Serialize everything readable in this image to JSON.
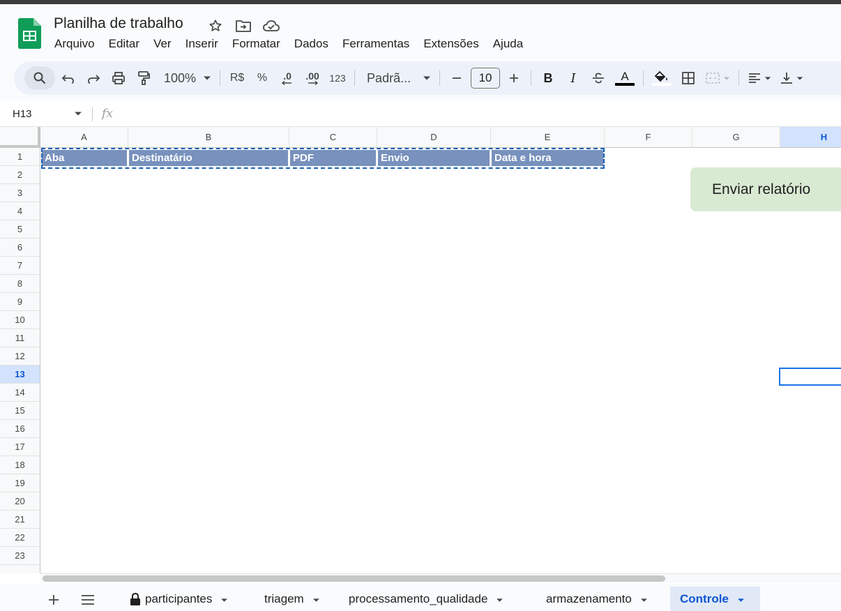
{
  "app": {
    "doc_title": "Planilha de trabalho",
    "title_icons": [
      "star-icon",
      "move-folder-icon",
      "cloud-saved-icon"
    ]
  },
  "menu": [
    "Arquivo",
    "Editar",
    "Ver",
    "Inserir",
    "Formatar",
    "Dados",
    "Ferramentas",
    "Extensões",
    "Ajuda"
  ],
  "toolbar": {
    "zoom": "100%",
    "currency": "R$",
    "percent": "%",
    "decrease_decimals": ".0",
    "increase_decimals": ".00",
    "more_formats": "123",
    "font": "Padrã...",
    "font_size": "10",
    "bold": "B",
    "italic": "I",
    "text_color_letter": "A",
    "text_color": "#000000"
  },
  "formula_bar": {
    "cell_ref": "H13",
    "fx": "fx"
  },
  "grid": {
    "columns": [
      "A",
      "B",
      "C",
      "D",
      "E",
      "F",
      "G",
      "H"
    ],
    "selected_column": "H",
    "rows": [
      "1",
      "2",
      "3",
      "4",
      "5",
      "6",
      "7",
      "8",
      "9",
      "10",
      "11",
      "12",
      "13",
      "14",
      "15",
      "16",
      "17",
      "18",
      "19",
      "20",
      "21",
      "22",
      "23"
    ],
    "selected_row": "13",
    "header_row": [
      "Aba",
      "Destinatário",
      "PDF",
      "Envio",
      "Data e hora"
    ],
    "header_fill": "#7891bd",
    "button_label": "Enviar relatório",
    "button_fill": "#d9ead3"
  },
  "sheets": {
    "tabs": [
      {
        "label": "participantes",
        "locked": true,
        "active": false
      },
      {
        "label": "triagem",
        "locked": false,
        "active": false
      },
      {
        "label": "processamento_qualidade",
        "locked": false,
        "active": false
      },
      {
        "label": "armazenamento",
        "locked": false,
        "active": false
      },
      {
        "label": "Controle",
        "locked": false,
        "active": true
      }
    ]
  }
}
